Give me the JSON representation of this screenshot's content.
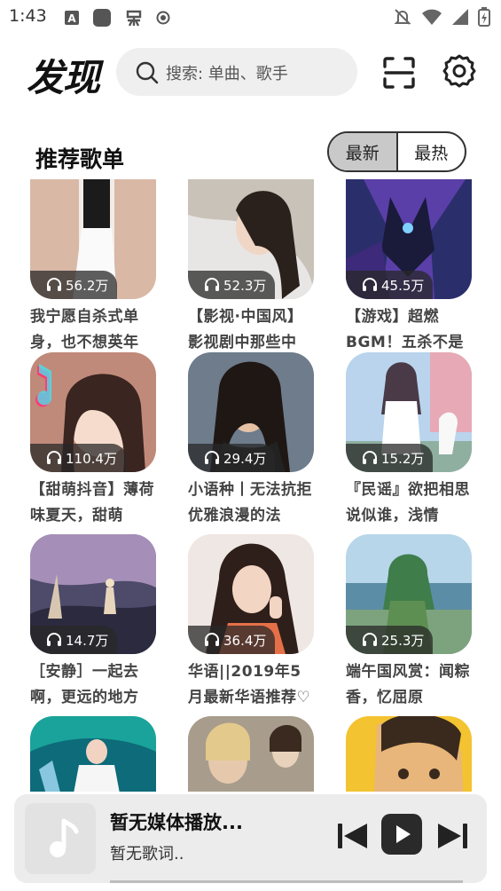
{
  "status_bar": {
    "time": "1:43",
    "left_icons": [
      "a-box-icon",
      "square-icon",
      "bug-icon",
      "record-icon"
    ],
    "right_icons": [
      "bell-off-icon",
      "wifi-icon",
      "signal-icon",
      "battery-charging-icon"
    ]
  },
  "header": {
    "title": "发现",
    "search_placeholder": "搜索: 单曲、歌手"
  },
  "section": {
    "title": "推荐歌单",
    "tabs": [
      {
        "label": "最新",
        "active": true
      },
      {
        "label": "最热",
        "active": false
      }
    ]
  },
  "playlists": [
    {
      "plays": "56.2万",
      "title": "我宁愿自杀式单身，也不想英年"
    },
    {
      "plays": "52.3万",
      "title": "【影视·中国风】影视剧中那些中"
    },
    {
      "plays": "45.5万",
      "title": "【游戏】超燃BGM！五杀不是"
    },
    {
      "plays": "110.4万",
      "title": "【甜萌抖音】薄荷味夏天，甜萌"
    },
    {
      "plays": "29.4万",
      "title": "小语种丨无法抗拒优雅浪漫的法"
    },
    {
      "plays": "15.2万",
      "title": "『民谣』欲把相思说似谁，浅情"
    },
    {
      "plays": "14.7万",
      "title": "［安静］一起去啊，更远的地方"
    },
    {
      "plays": "36.4万",
      "title": "华语||2019年5月最新华语推荐♡"
    },
    {
      "plays": "25.3万",
      "title": "端午国风赏：闻粽香，忆屈原"
    },
    {
      "plays": "",
      "title": ""
    },
    {
      "plays": "",
      "title": ""
    },
    {
      "plays": "",
      "title": ""
    }
  ],
  "player": {
    "title": "暂无媒体播放...",
    "lyric": "暂无歌词.."
  }
}
